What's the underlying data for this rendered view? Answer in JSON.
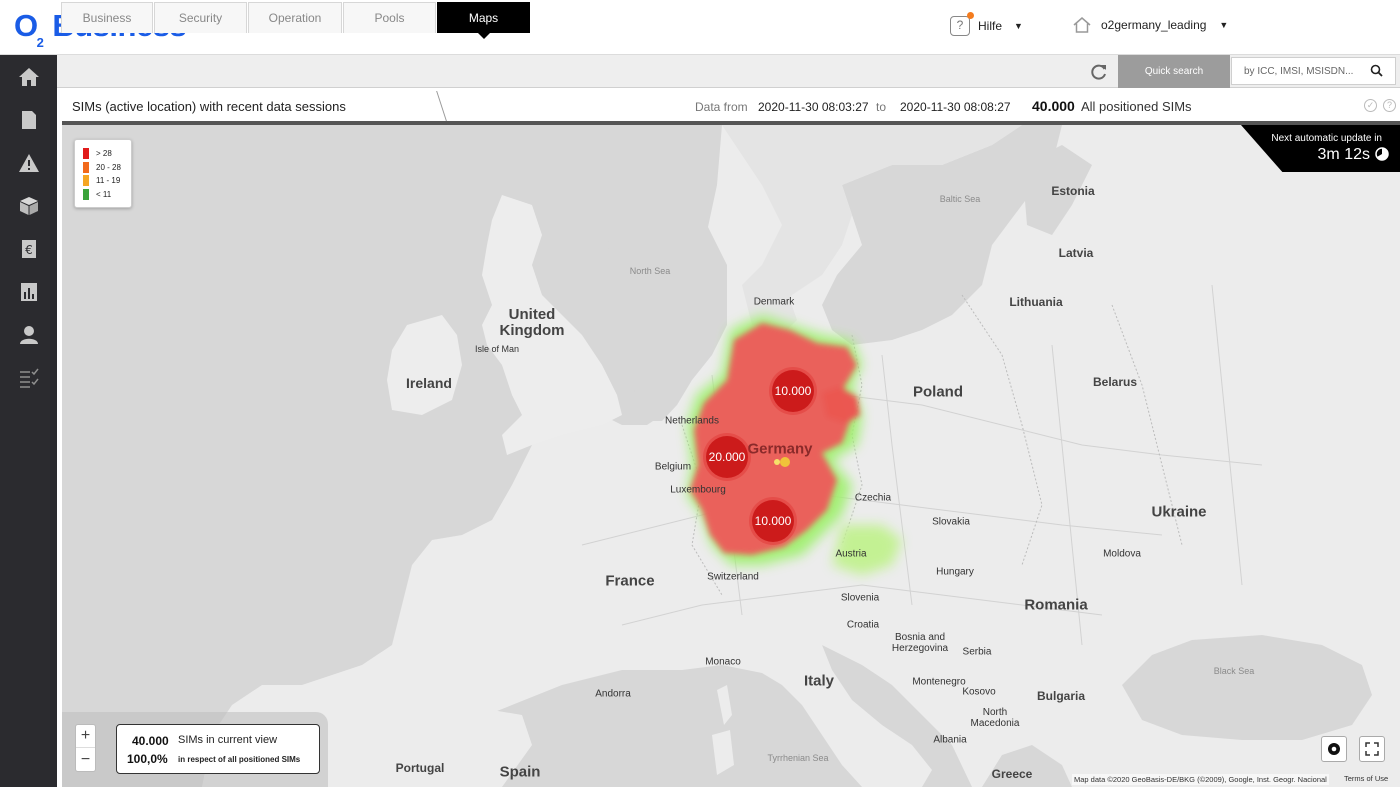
{
  "header": {
    "logo_o": "O",
    "logo_sub": "2",
    "logo_brand": "Business",
    "help_label": "Hilfe",
    "account_label": "o2germany_leading",
    "caret": "▼"
  },
  "sidebar": {
    "items": [
      {
        "icon": "home-icon"
      },
      {
        "icon": "document-icon"
      },
      {
        "icon": "warning-icon"
      },
      {
        "icon": "box-icon"
      },
      {
        "icon": "euro-icon"
      },
      {
        "icon": "bar-chart-icon"
      },
      {
        "icon": "user-icon"
      },
      {
        "icon": "checklist-icon"
      }
    ]
  },
  "tabs": {
    "items": [
      {
        "label": "Business"
      },
      {
        "label": "Security"
      },
      {
        "label": "Operation"
      },
      {
        "label": "Pools"
      },
      {
        "label": "Maps"
      }
    ],
    "active": "Maps"
  },
  "search": {
    "label": "Quick search",
    "placeholder": "by ICC, IMSI, MSISDN..."
  },
  "info": {
    "title": "SIMs (active location) with recent data sessions",
    "data_from_label": "Data from",
    "from": "2020-11-30 08:03:27",
    "to_label": "to",
    "to": "2020-11-30 08:08:27",
    "total": "40.000",
    "total_label": "All positioned SIMs"
  },
  "legend": {
    "items": [
      {
        "label": "> 28",
        "color": "#e11b1b"
      },
      {
        "label": "20 - 28",
        "color": "#f26a1b"
      },
      {
        "label": "11 - 19",
        "color": "#f5a623"
      },
      {
        "label": "< 11",
        "color": "#3aa33a"
      }
    ]
  },
  "update": {
    "label": "Next automatic update in",
    "time": "3m 12s"
  },
  "clusters": [
    {
      "value": "10.000"
    },
    {
      "value": "20.000"
    },
    {
      "value": "10.000"
    }
  ],
  "places": {
    "countries": {
      "uk": "United Kingdom",
      "ireland": "Ireland",
      "poland": "Poland",
      "germany": "Germany",
      "france": "France",
      "ukraine": "Ukraine",
      "romania": "Romania",
      "italy": "Italy",
      "spain": "Spain",
      "belarus": "Belarus",
      "latvia": "Latvia",
      "lithuania": "Lithuania",
      "estonia": "Estonia"
    },
    "others": {
      "denmark": "Denmark",
      "netherlands": "Netherlands",
      "belgium": "Belgium",
      "luxembourg": "Luxembourg",
      "czechia": "Czechia",
      "slovakia": "Slovakia",
      "austria": "Austria",
      "hungary": "Hungary",
      "switzerland": "Switzerland",
      "slovenia": "Slovenia",
      "croatia": "Croatia",
      "bosnia": "Bosnia and Herzegovina",
      "serbia": "Serbia",
      "montenegro": "Montenegro",
      "kosovo": "Kosovo",
      "north_macedonia": "North Macedonia",
      "albania": "Albania",
      "bulgaria": "Bulgaria",
      "greece": "Greece",
      "moldova": "Moldova",
      "monaco": "Monaco",
      "andorra": "Andorra",
      "portugal": "Portugal",
      "isle_of_man": "Isle of Man"
    },
    "seas": {
      "north_sea": "North Sea",
      "baltic_sea": "Baltic Sea",
      "black_sea": "Black Sea",
      "tyrrhenian": "Tyrrhenian Sea"
    }
  },
  "view_stats": {
    "count": "40.000",
    "count_label": "SIMs in current view",
    "percent": "100,0%",
    "percent_label": "in respect of all positioned SIMs"
  },
  "zoom": {
    "plus": "+",
    "minus": "−"
  },
  "footer": {
    "attribution": "Map data ©2020 GeoBasis-DE/BKG (©2009), Google, Inst. Geogr. Nacional",
    "terms": "Terms of Use"
  }
}
